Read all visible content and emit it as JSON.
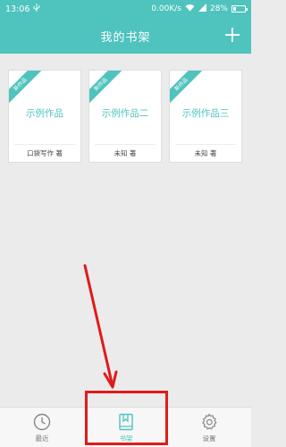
{
  "status_bar": {
    "time": "13:06",
    "network_speed": "0.00K/s",
    "battery": "28%",
    "battery_level": 0.28
  },
  "header": {
    "title": "我的书架",
    "add_icon": "plus-icon"
  },
  "books": [
    {
      "ribbon": "新作品",
      "title": "示例作品",
      "author": "口袋写作 著"
    },
    {
      "ribbon": "新作品",
      "title": "示例作品二",
      "author": "未知 著"
    },
    {
      "ribbon": "新作品",
      "title": "示例作品三",
      "author": "未知 著"
    }
  ],
  "tabs": [
    {
      "label": "最近",
      "icon": "clock-icon",
      "active": false
    },
    {
      "label": "书架",
      "icon": "bookshelf-icon",
      "active": true
    },
    {
      "label": "设置",
      "icon": "gear-icon",
      "active": false
    }
  ],
  "colors": {
    "accent": "#4fc3be",
    "annotation": "#e01b1b",
    "background": "#ebebeb"
  }
}
